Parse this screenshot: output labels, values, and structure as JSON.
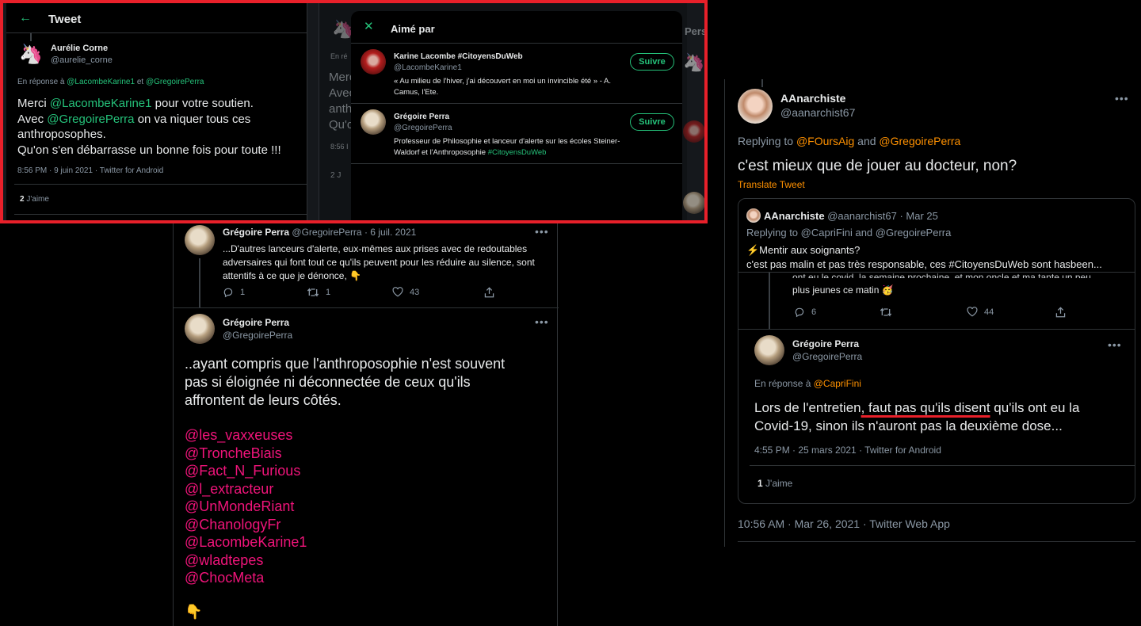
{
  "tweet_panel": {
    "header_title": "Tweet",
    "author_name": "Aurélie Corne",
    "author_handle": "@aurelie_corne",
    "reply_prefix": "En réponse à",
    "reply_to_1": "@LacombeKarine1",
    "reply_and": "et",
    "reply_to_2": "@GregoirePerra",
    "text_l1a": "Merci ",
    "text_l1_mention": "@LacombeKarine1",
    "text_l1b": " pour votre soutien.",
    "text_l2a": "Avec ",
    "text_l2_mention": "@GregoirePerra",
    "text_l2b": " on va niquer tous ces",
    "text_l3": "anthroposophes.",
    "text_l4": "Qu'on s'en débarrasse un bonne fois pour toute !!!",
    "meta": "8:56 PM · 9 juin 2021 · Twitter for Android",
    "likes_count": "2",
    "likes_label": "J'aime"
  },
  "bg_tweet": {
    "lines": [
      "En ré",
      "Merc",
      "Avec",
      "anth",
      "Qu'c",
      "8:56 I",
      "2 J"
    ],
    "persona_fragment": "Perso"
  },
  "liked_modal": {
    "title": "Aimé par",
    "users": [
      {
        "name": "Karine Lacombe #CitoyensDuWeb",
        "handle": "@LacombeKarine1",
        "bio_l1": "« Au milieu de l'hiver, j'ai découvert en moi un invincible été » - A.",
        "bio_l2": "Camus, l'Ete.",
        "button": "Suivre"
      },
      {
        "name": "Grégoire Perra",
        "handle": "@GregoirePerra",
        "bio_l1": "Professeur de Philosophie et lanceur d'alerte sur les écoles Steiner-",
        "bio_l2a": "Waldorf et l'Anthroposophie ",
        "bio_l2_tag": "#CitoyensDuWeb",
        "button": "Suivre"
      }
    ]
  },
  "middle_thread": {
    "tweet1": {
      "name": "Grégoire Perra",
      "handle": "@GregoirePerra",
      "date": "· 6 juil. 2021",
      "l1": "...D'autres lanceurs d'alerte, eux-mêmes aux prises avec de redoutables",
      "l2": "adversaires qui font tout ce qu'ils peuvent pour les réduire au silence, sont",
      "l3": "attentifs à ce que je dénonce, 👇",
      "replies": "1",
      "retweets": "1",
      "likes": "43"
    },
    "tweet2": {
      "name": "Grégoire Perra",
      "handle": "@GregoirePerra",
      "l1": "..ayant compris que l'anthroposophie n'est souvent",
      "l2": "pas si éloignée ni déconnectée de ceux qu'ils",
      "l3": "affrontent de leurs côtés.",
      "mentions": [
        "@les_vaxxeuses",
        "@TroncheBiais",
        "@Fact_N_Furious",
        "@l_extracteur",
        "@UnMondeRiant",
        "@ChanologyFr",
        "@LacombeKarine1",
        "@wladtepes",
        "@ChocMeta"
      ],
      "emoji": "👇"
    }
  },
  "right_panel": {
    "name": "AAnarchiste",
    "handle": "@aanarchist67",
    "replying_prefix": "Replying to ",
    "replying_1": "@FOursAig",
    "replying_and": " and ",
    "replying_2": "@GregoirePerra",
    "text": "c'est mieux que de jouer au docteur, non?",
    "translate": "Translate Tweet",
    "quote": {
      "name": "AAnarchiste",
      "handle": "@aanarchist67 · Mar 25",
      "replying": "Replying to @CapriFini and @GregoirePerra",
      "l1": "⚡Mentir aux soignants?",
      "l2": "c'est pas malin et pas très responsable, ces #CitoyensDuWeb sont hasbeen...",
      "inner_cut": "ont eu le covid, la semaine prochaine, et mon oncle et ma tante un peu",
      "inner_l2": "plus jeunes ce matin 🥳",
      "replies": "6",
      "likes": "44",
      "gp_name": "Grégoire Perra",
      "gp_handle": "@GregoirePerra",
      "gp_reply_prefix": "En réponse à ",
      "gp_reply_to": "@CapriFini",
      "gp_l1a": "Lors de l'entretien",
      "gp_l1b": ", faut pas qu'ils disent",
      "gp_l1c": " qu'ils ont eu la",
      "gp_l2": "Covid-19,  sinon ils n'auront pas la deuxième dose...",
      "gp_meta": "4:55 PM · 25 mars 2021 · Twitter for Android",
      "gp_likes": "1",
      "gp_likes_label": "J'aime"
    },
    "meta": "10:56 AM · Mar 26, 2021 · Twitter Web App"
  },
  "colors": {
    "highlight_border": "#e8202a",
    "link_green": "#25c27a",
    "link_pink": "#f0147a",
    "link_orange": "#ff9100",
    "underline_red": "#e8202a"
  }
}
